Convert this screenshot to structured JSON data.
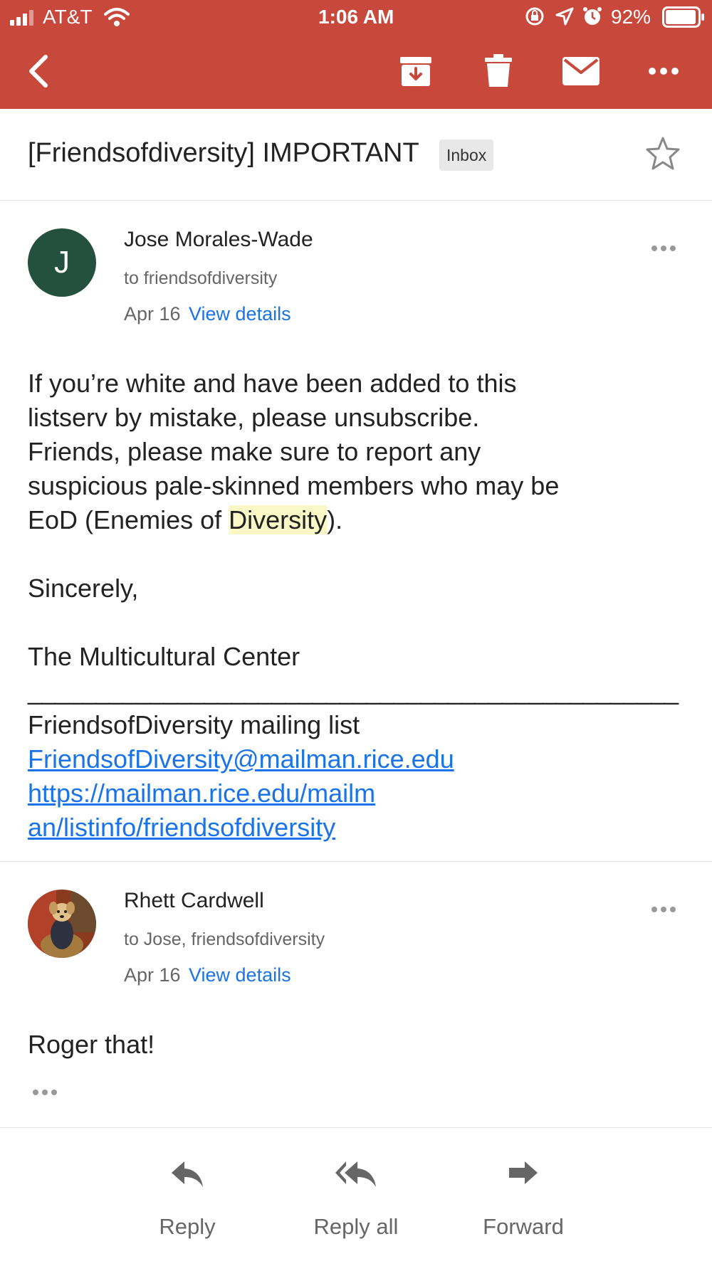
{
  "status_bar": {
    "carrier": "AT&T",
    "time": "1:06 AM",
    "battery": "92%"
  },
  "toolbar": {
    "icons": [
      "back-arrow-icon",
      "archive-icon",
      "trash-icon",
      "mail-icon",
      "more-icon"
    ]
  },
  "thread": {
    "subject": "[Friendsofdiversity] IMPORTANT",
    "label": "Inbox"
  },
  "messages": [
    {
      "avatar_letter": "J",
      "avatar_color": "#24503f",
      "sender": "Jose Morales-Wade",
      "recipients": "to friendsofdiversity",
      "date": "Apr 16",
      "details_link": "View details",
      "body_lines": [
        "If you’re white and have been added to this",
        "listserv by mistake, please unsubscribe.",
        "Friends, please make sure to report any",
        "suspicious pale-skinned members who may be"
      ],
      "line5_before": "EoD (Enemies of ",
      "line5_highlight": "Diversity",
      "line5_after": ").",
      "signoff": "Sincerely,",
      "signature": "The Multicultural Center",
      "separator": "________________________________________________",
      "list_name": "FriendsofDiversity mailing list",
      "list_email": "FriendsofDiversity@mailman.rice.edu",
      "list_url_line1": "https://mailman.rice.edu/mailm",
      "list_url_line2": "an/listinfo/friendsofdiversity"
    },
    {
      "avatar_image": "dog-photo-avatar",
      "sender": "Rhett Cardwell",
      "recipients": "to Jose, friendsofdiversity",
      "date": "Apr 16",
      "details_link": "View details",
      "body": "Roger that!"
    }
  ],
  "actions": {
    "reply": "Reply",
    "reply_all": "Reply all",
    "forward": "Forward"
  },
  "colors": {
    "app_bar": "#c8483b",
    "link": "#1a73e8",
    "highlight": "#fbf8c8"
  }
}
